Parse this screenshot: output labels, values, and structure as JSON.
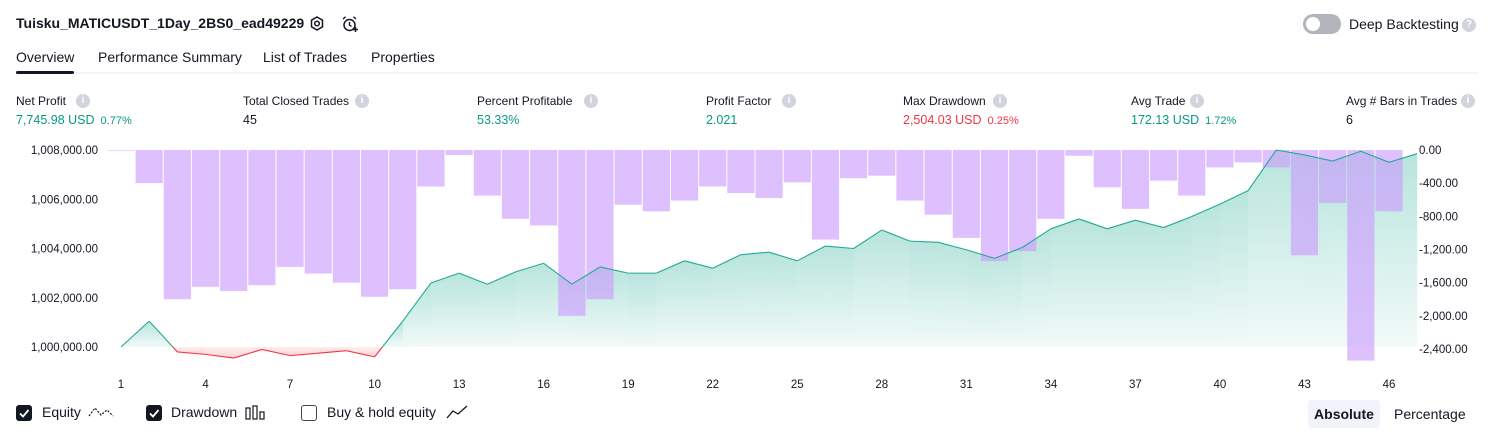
{
  "header": {
    "title": "Tuisku_MATICUSDT_1Day_2BS0_ead49229",
    "deep_backtesting_label": "Deep Backtesting",
    "help_glyph": "?"
  },
  "tabs": [
    "Overview",
    "Performance Summary",
    "List of Trades",
    "Properties"
  ],
  "metrics": [
    {
      "label": "Net Profit",
      "value": "7,745.98 USD",
      "pct": "0.77%",
      "color": "green"
    },
    {
      "label": "Total Closed Trades",
      "value": "45",
      "pct": "",
      "color": "dark"
    },
    {
      "label": "Percent Profitable",
      "value": "53.33%",
      "pct": "",
      "color": "green"
    },
    {
      "label": "Profit Factor",
      "value": "2.021",
      "pct": "",
      "color": "green"
    },
    {
      "label": "Max Drawdown",
      "value": "2,504.03 USD",
      "pct": "0.25%",
      "color": "red"
    },
    {
      "label": "Avg Trade",
      "value": "172.13 USD",
      "pct": "1.72%",
      "color": "green"
    },
    {
      "label": "Avg # Bars in Trades",
      "value": "6",
      "pct": "",
      "color": "dark"
    }
  ],
  "chart_data": {
    "type": "line",
    "series": [
      {
        "values": [
          1000000,
          1001050,
          999800,
          999700,
          999550,
          999900,
          999650,
          999750,
          999850,
          999600,
          1001050,
          1002600,
          1003000,
          1002550,
          1003050,
          1003400,
          1002550,
          1003250,
          1003000,
          1003000,
          1003500,
          1003200,
          1003750,
          1003850,
          1003500,
          1004100,
          1004000,
          1004750,
          1004300,
          1004250,
          1003950,
          1003600,
          1004050,
          1004800,
          1005200,
          1004800,
          1005150,
          1004850,
          1005300,
          1005800,
          1006350,
          1008000,
          1007800,
          1007550,
          1007950,
          1007500,
          1007850
        ]
      },
      {
        "values": [
          0,
          -400,
          -1800,
          -1650,
          -1700,
          -1630,
          -1410,
          -1490,
          -1600,
          -1770,
          -1680,
          -440,
          -60,
          -550,
          -830,
          -910,
          -2000,
          -1800,
          -660,
          -740,
          -610,
          -440,
          -520,
          -580,
          -390,
          -1080,
          -340,
          -310,
          -610,
          -780,
          -1060,
          -1340,
          -1220,
          -830,
          -70,
          -450,
          -710,
          -370,
          -550,
          -210,
          -150,
          -210,
          -1270,
          -640,
          -2540,
          -740
        ]
      }
    ],
    "x_ticks": [
      "1",
      "4",
      "7",
      "10",
      "13",
      "16",
      "19",
      "22",
      "25",
      "28",
      "31",
      "34",
      "37",
      "40",
      "43",
      "46"
    ],
    "y_left_ticks": [
      "1,008,000.00",
      "1,006,000.00",
      "1,004,000.00",
      "1,002,000.00",
      "1,000,000.00"
    ],
    "y_right_ticks": [
      "0.00",
      "-400.00",
      "-800.00",
      "-1,200.00",
      "-1,600.00",
      "-2,000.00",
      "-2,400.00"
    ],
    "y_left_range": [
      1000000,
      1008000
    ],
    "y_right_range": [
      -2400,
      0
    ],
    "colors": {
      "line_up": "#22ab94",
      "line_down": "#f23645",
      "area_up": "#22ab94",
      "area_down": "#f23645",
      "bars": "#cc99ff"
    }
  },
  "legend": {
    "equity": "Equity",
    "drawdown": "Drawdown",
    "buy_hold": "Buy & hold equity"
  },
  "view_buttons": {
    "absolute": "Absolute",
    "percentage": "Percentage"
  }
}
